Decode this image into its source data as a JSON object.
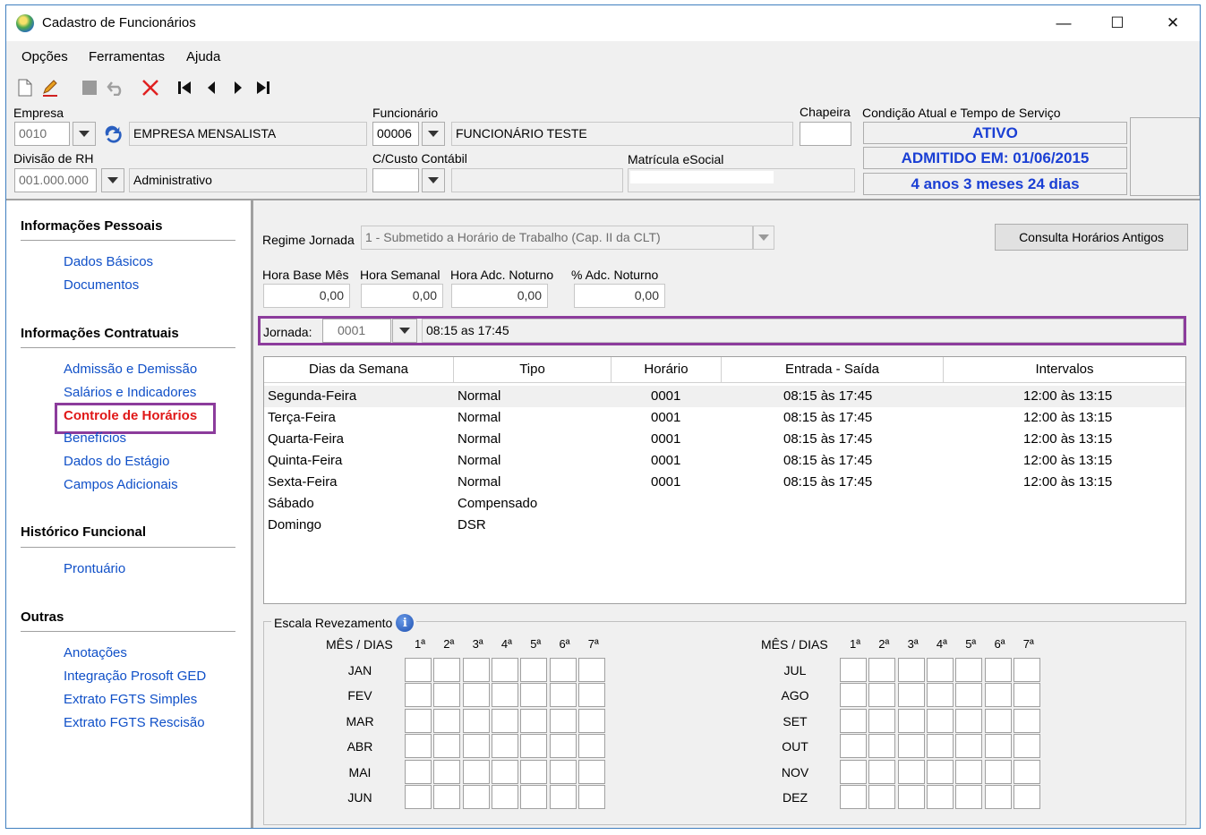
{
  "window": {
    "title": "Cadastro de Funcionários",
    "minimize": "—",
    "maximize": "☐",
    "close": "✕"
  },
  "menu": [
    "Opções",
    "Ferramentas",
    "Ajuda"
  ],
  "toolbar_icons": [
    "new-icon",
    "edit-icon",
    "save-icon",
    "undo-icon",
    "delete-icon",
    "first-icon",
    "prev-icon",
    "next-icon",
    "last-icon"
  ],
  "header": {
    "empresa_label": "Empresa",
    "empresa_code": "0010",
    "empresa_name": "EMPRESA MENSALISTA",
    "funcionario_label": "Funcionário",
    "funcionario_code": "00006",
    "funcionario_name": "FUNCIONÁRIO TESTE",
    "chapeira_label": "Chapeira",
    "chapeira_value": "",
    "divisao_label": "Divisão de RH",
    "divisao_code": "001.000.000",
    "divisao_name": "Administrativo",
    "ccusto_label": "C/Custo Contábil",
    "matricula_label": "Matrícula eSocial",
    "condicao_label": "Condição Atual e Tempo de Serviço",
    "status": "ATIVO",
    "admitido": "ADMITIDO EM: 01/06/2015",
    "tempo": "4 anos 3 meses 24 dias"
  },
  "sidebar": {
    "sections": [
      {
        "title": "Informações Pessoais",
        "items": [
          "Dados Básicos",
          "Documentos"
        ]
      },
      {
        "title": "Informações Contratuais",
        "items": [
          "Admissão e Demissão",
          "Salários e Indicadores",
          "Controle de Horários",
          "Benefícios",
          "Dados do Estágio",
          "Campos Adicionais"
        ]
      },
      {
        "title": "Histórico Funcional",
        "items": [
          "Prontuário"
        ]
      },
      {
        "title": "Outras",
        "items": [
          "Anotações",
          "Integração Prosoft GED",
          "Extrato FGTS Simples",
          "Extrato FGTS Rescisão"
        ]
      }
    ],
    "active_item": "Controle de Horários"
  },
  "main": {
    "regime_label": "Regime Jornada",
    "regime_value": "1 - Submetido a Horário de Trabalho (Cap. II da CLT)",
    "consulta_button": "Consulta Horários Antigos",
    "hora_base_label": "Hora Base Mês",
    "hora_base_value": "0,00",
    "hora_semanal_label": "Hora Semanal",
    "hora_semanal_value": "0,00",
    "hora_adc_label": "Hora Adc. Noturno",
    "hora_adc_value": "0,00",
    "pct_adc_label": "% Adc. Noturno",
    "pct_adc_value": "0,00",
    "jornada_label": "Jornada:",
    "jornada_code": "0001",
    "jornada_desc": "08:15 as 17:45"
  },
  "table": {
    "columns": [
      "Dias da Semana",
      "Tipo",
      "Horário",
      "Entrada - Saída",
      "Intervalos"
    ],
    "rows": [
      [
        "Segunda-Feira",
        "Normal",
        "0001",
        "08:15 às 17:45",
        "12:00 às 13:15"
      ],
      [
        "Terça-Feira",
        "Normal",
        "0001",
        "08:15 às 17:45",
        "12:00 às 13:15"
      ],
      [
        "Quarta-Feira",
        "Normal",
        "0001",
        "08:15 às 17:45",
        "12:00 às 13:15"
      ],
      [
        "Quinta-Feira",
        "Normal",
        "0001",
        "08:15 às 17:45",
        "12:00 às 13:15"
      ],
      [
        "Sexta-Feira",
        "Normal",
        "0001",
        "08:15 às 17:45",
        "12:00 às 13:15"
      ],
      [
        "Sábado",
        "Compensado",
        "",
        "",
        ""
      ],
      [
        "Domingo",
        "DSR",
        "",
        "",
        ""
      ]
    ]
  },
  "escala": {
    "title": "Escala Revezamento",
    "mes_dias": "MÊS / DIAS",
    "days": [
      "1ª",
      "2ª",
      "3ª",
      "4ª",
      "5ª",
      "6ª",
      "7ª"
    ],
    "months_left": [
      "JAN",
      "FEV",
      "MAR",
      "ABR",
      "MAI",
      "JUN"
    ],
    "months_right": [
      "JUL",
      "AGO",
      "SET",
      "OUT",
      "NOV",
      "DEZ"
    ]
  }
}
